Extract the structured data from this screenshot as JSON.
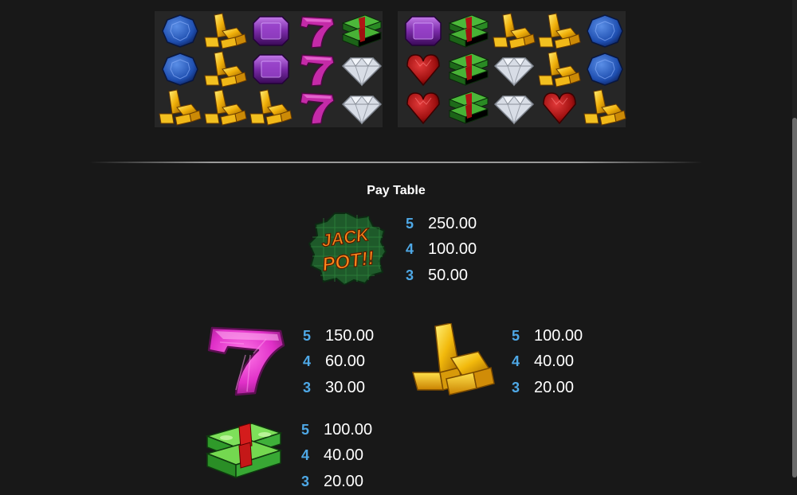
{
  "reels": {
    "grid1": [
      [
        "sapphire",
        "gold",
        "amethyst",
        "seven",
        "cash"
      ],
      [
        "sapphire",
        "gold",
        "amethyst",
        "seven",
        "diamond"
      ],
      [
        "gold",
        "gold",
        "gold",
        "seven",
        "diamond"
      ]
    ],
    "grid2": [
      [
        "amethyst",
        "cash",
        "gold",
        "gold",
        "sapphire"
      ],
      [
        "ruby",
        "cash",
        "diamond",
        "gold",
        "sapphire"
      ],
      [
        "ruby",
        "cash",
        "diamond",
        "ruby",
        "gold"
      ]
    ]
  },
  "paytable": {
    "title": "Pay Table",
    "jackpot": {
      "icon": "jackpot-icon",
      "logo_text": [
        "JACK",
        "POT!!"
      ],
      "rows": [
        {
          "count": "5",
          "amount": "250.00"
        },
        {
          "count": "4",
          "amount": "100.00"
        },
        {
          "count": "3",
          "amount": "50.00"
        }
      ]
    },
    "seven": {
      "icon": "seven-icon",
      "rows": [
        {
          "count": "5",
          "amount": "150.00"
        },
        {
          "count": "4",
          "amount": "60.00"
        },
        {
          "count": "3",
          "amount": "30.00"
        }
      ]
    },
    "gold": {
      "icon": "gold-bars-icon",
      "rows": [
        {
          "count": "5",
          "amount": "100.00"
        },
        {
          "count": "4",
          "amount": "40.00"
        },
        {
          "count": "3",
          "amount": "20.00"
        }
      ]
    },
    "cash": {
      "icon": "cash-stack-icon",
      "rows": [
        {
          "count": "5",
          "amount": "100.00"
        },
        {
          "count": "4",
          "amount": "40.00"
        },
        {
          "count": "3",
          "amount": "20.00"
        }
      ]
    }
  },
  "colors": {
    "background": "#181818",
    "panel": "#262626",
    "count": "#4ea8e6",
    "amount": "#ffffff"
  }
}
